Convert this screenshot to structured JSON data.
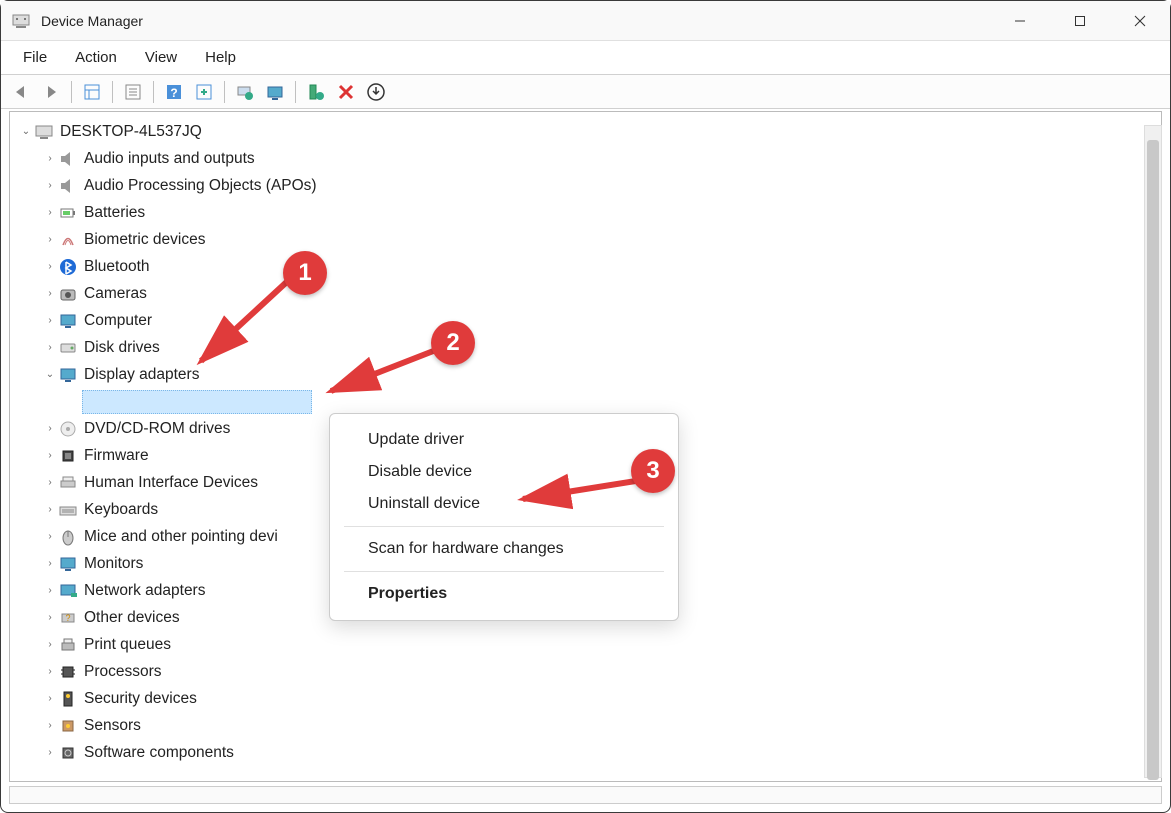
{
  "window": {
    "title": "Device Manager"
  },
  "menubar": {
    "items": [
      "File",
      "Action",
      "View",
      "Help"
    ]
  },
  "tree": {
    "root": "DESKTOP-4L537JQ",
    "nodes": [
      {
        "label": "Audio inputs and outputs",
        "icon": "speaker"
      },
      {
        "label": "Audio Processing Objects (APOs)",
        "icon": "speaker"
      },
      {
        "label": "Batteries",
        "icon": "battery"
      },
      {
        "label": "Biometric devices",
        "icon": "fingerprint"
      },
      {
        "label": "Bluetooth",
        "icon": "bluetooth"
      },
      {
        "label": "Cameras",
        "icon": "camera"
      },
      {
        "label": "Computer",
        "icon": "monitor"
      },
      {
        "label": "Disk drives",
        "icon": "disk"
      },
      {
        "label": "Display adapters",
        "icon": "display",
        "expanded": true
      },
      {
        "label": "DVD/CD-ROM drives",
        "icon": "cd"
      },
      {
        "label": "Firmware",
        "icon": "chip"
      },
      {
        "label": "Human Interface Devices",
        "icon": "hid"
      },
      {
        "label": "Keyboards",
        "icon": "keyboard"
      },
      {
        "label": "Mice and other pointing devi",
        "icon": "mouse",
        "clipped": true
      },
      {
        "label": "Monitors",
        "icon": "monitor"
      },
      {
        "label": "Network adapters",
        "icon": "network"
      },
      {
        "label": "Other devices",
        "icon": "other"
      },
      {
        "label": "Print queues",
        "icon": "printer"
      },
      {
        "label": "Processors",
        "icon": "cpu"
      },
      {
        "label": "Security devices",
        "icon": "security"
      },
      {
        "label": "Sensors",
        "icon": "sensor"
      },
      {
        "label": "Software components",
        "icon": "software"
      }
    ]
  },
  "context_menu": {
    "items": [
      {
        "label": "Update driver"
      },
      {
        "label": "Disable device"
      },
      {
        "label": "Uninstall device"
      },
      {
        "sep": true
      },
      {
        "label": "Scan for hardware changes"
      },
      {
        "sep": true
      },
      {
        "label": "Properties",
        "bold": true
      }
    ]
  },
  "annotations": {
    "b1": "1",
    "b2": "2",
    "b3": "3"
  }
}
